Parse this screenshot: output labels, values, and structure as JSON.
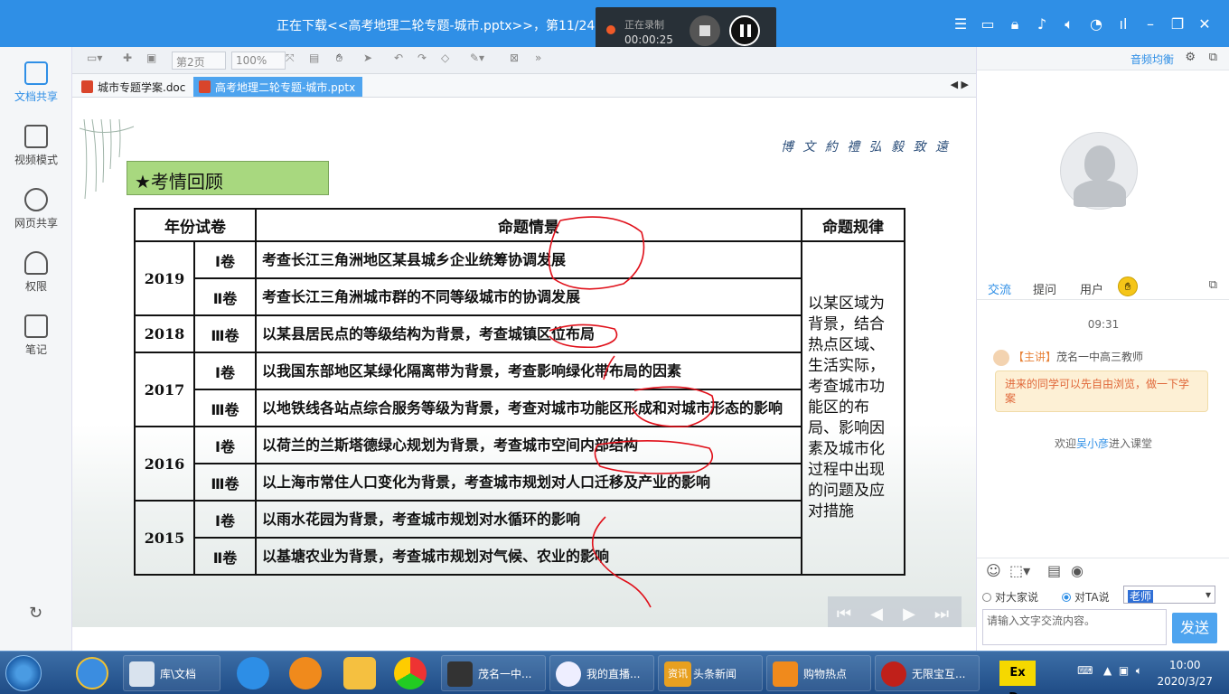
{
  "titlebar": {
    "title": "正在下载<<高考地理二轮专题-城市.pptx>>，第11/24"
  },
  "recording": {
    "label": "正在录制",
    "time": "00:00:25"
  },
  "sidebar": {
    "items": [
      {
        "label": "文档共享"
      },
      {
        "label": "视频模式"
      },
      {
        "label": "网页共享"
      },
      {
        "label": "权限"
      },
      {
        "label": "笔记"
      }
    ]
  },
  "toolbar": {
    "page": "第2页",
    "zoom": "100%"
  },
  "tabs": [
    {
      "label": "城市专题学案.doc"
    },
    {
      "label": "高考地理二轮专题-城市.pptx"
    }
  ],
  "slide": {
    "motto": "博 文 約 禮   弘 毅 致 遠",
    "heading": "★考情回顾",
    "table": {
      "headers": [
        "年份试卷",
        "命题情景",
        "命题规律"
      ],
      "rule": "以某区域为背景，结合热点区域、生活实际，考查城市功能区的布局、影响因素及城市化过程中出现的问题及应对措施",
      "years": [
        "2019",
        "2018",
        "2017",
        "2016",
        "2015"
      ],
      "rows": [
        {
          "vol": "Ⅰ卷",
          "topic": "考查长江三角洲地区某县城乡企业统筹协调发展"
        },
        {
          "vol": "Ⅱ卷",
          "topic": "考查长江三角洲城市群的不同等级城市的协调发展"
        },
        {
          "vol": "Ⅲ卷",
          "topic": "以某县居民点的等级结构为背景，考查城镇区位布局"
        },
        {
          "vol": "Ⅰ卷",
          "topic": "以我国东部地区某绿化隔离带为背景，考查影响绿化带布局的因素"
        },
        {
          "vol": "Ⅲ卷",
          "topic": "以地铁线各站点综合服务等级为背景，考查对城市功能区形成和对城市形态的影响"
        },
        {
          "vol": "Ⅰ卷",
          "topic": "以荷兰的兰斯塔德绿心规划为背景，考查城市空间内部结构"
        },
        {
          "vol": "Ⅲ卷",
          "topic": "以上海市常住人口变化为背景，考查城市规划对人口迁移及产业的影响"
        },
        {
          "vol": "Ⅰ卷",
          "topic": "以雨水花园为背景，考查城市规划对水循环的影响"
        },
        {
          "vol": "Ⅱ卷",
          "topic": "以基塘农业为背景，考查城市规划对气候、农业的影响"
        }
      ]
    }
  },
  "right_panel": {
    "balance_label": "音频均衡",
    "tabs": [
      "交流",
      "提问",
      "用户"
    ],
    "chat_time": "09:31",
    "sender_tag": "【主讲】",
    "sender_name": "茂名一中高三教师",
    "message": "进来的同学可以先自由浏览，做一下学案",
    "welcome_prefix": "欢迎",
    "welcome_user": "吴小彦",
    "welcome_suffix": "进入课堂",
    "mode_all": "对大家说",
    "mode_ta": "对TA说",
    "target": "老师",
    "input_placeholder": "请输入文字交流内容。",
    "send_label": "发送"
  },
  "taskbar": {
    "items": [
      {
        "label": "库\\文档"
      },
      {
        "label": "茂名一中..."
      },
      {
        "label": "我的直播..."
      },
      {
        "label": "头条新闻"
      },
      {
        "label": "购物热点"
      },
      {
        "label": "无限宝互..."
      }
    ],
    "app_badge": "资讯",
    "exde": "Ex De",
    "time": "10:00",
    "date": "2020/3/27"
  },
  "colors": {
    "titlebar": "#2f8fe6",
    "accent": "#2f8fe6",
    "heading_bg": "#a8d87f",
    "annotation": "#e0101a"
  }
}
